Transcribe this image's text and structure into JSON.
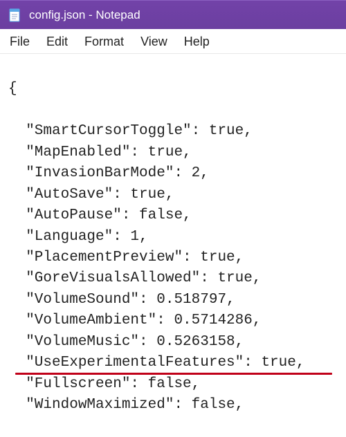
{
  "window": {
    "title": "config.json - Notepad"
  },
  "menu": {
    "file": "File",
    "edit": "Edit",
    "format": "Format",
    "view": "View",
    "help": "Help"
  },
  "doc": {
    "open_brace": "{",
    "lines": [
      "  \"SmartCursorToggle\": true,",
      "  \"MapEnabled\": true,",
      "  \"InvasionBarMode\": 2,",
      "  \"AutoSave\": true,",
      "  \"AutoPause\": false,",
      "  \"Language\": 1,",
      "  \"PlacementPreview\": true,",
      "  \"GoreVisualsAllowed\": true,",
      "  \"VolumeSound\": 0.518797,",
      "  \"VolumeAmbient\": 0.5714286,",
      "  \"VolumeMusic\": 0.5263158,",
      "  \"UseExperimentalFeatures\": true,",
      "  \"Fullscreen\": false,",
      "  \"WindowMaximized\": false,"
    ],
    "highlight_index": 11
  }
}
